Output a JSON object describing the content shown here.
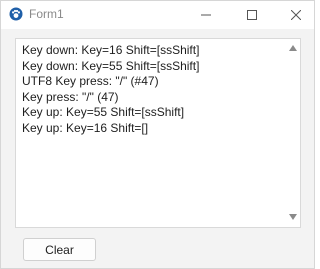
{
  "window": {
    "title": "Form1",
    "app_icon": "paw-icon"
  },
  "titlebar_buttons": {
    "minimize": "minimize-icon",
    "maximize": "maximize-icon",
    "close": "close-icon"
  },
  "log": {
    "lines": [
      "Key down: Key=16 Shift=[ssShift]",
      "Key down: Key=55 Shift=[ssShift]",
      "UTF8 Key press: \"/\" (#47)",
      "Key press: \"/\" (47)",
      "Key up: Key=55 Shift=[ssShift]",
      "Key up: Key=16 Shift=[]"
    ]
  },
  "buttons": {
    "clear_label": "Clear"
  }
}
